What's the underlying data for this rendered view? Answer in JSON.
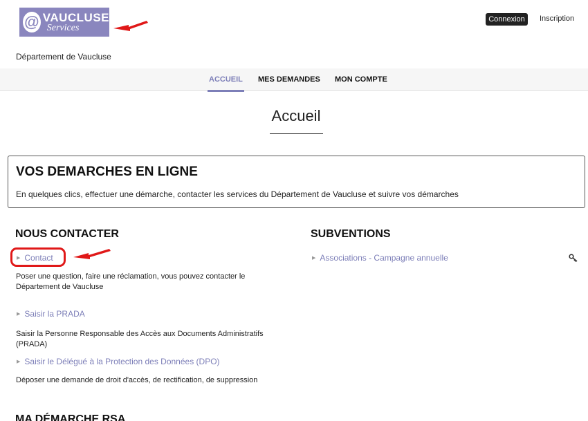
{
  "header": {
    "logo": {
      "at_symbol": "@",
      "main_text": "VAUCLUSE",
      "sub_text": "Services"
    },
    "login_button": "Connexion",
    "signup_link": "Inscription",
    "department": "Département de Vaucluse"
  },
  "nav": {
    "items": [
      {
        "label": "ACCUEIL",
        "active": true
      },
      {
        "label": "MES DEMANDES",
        "active": false
      },
      {
        "label": "MON COMPTE",
        "active": false
      }
    ]
  },
  "page_title": "Accueil",
  "demarches_box": {
    "heading": "VOS DEMARCHES EN LIGNE",
    "text": "En quelques clics, effectuer une démarche, contacter les services du Département de Vaucluse et suivre vos démarches"
  },
  "contact_section": {
    "title": "NOUS CONTACTER",
    "items": [
      {
        "label": "Contact",
        "description": "Poser une question, faire une réclamation, vous pouvez contacter le Département de Vaucluse"
      },
      {
        "label": "Saisir la PRADA",
        "description": "Saisir la Personne Responsable des Accès aux Documents Administratifs (PRADA)"
      },
      {
        "label": "Saisir le Délégué à la Protection des Données (DPO)",
        "description": "Déposer une demande de droit d'accès, de rectification, de suppression"
      }
    ]
  },
  "subventions_section": {
    "title": "SUBVENTIONS",
    "items": [
      {
        "label": "Associations - Campagne annuelle",
        "icon": "key-icon"
      }
    ]
  },
  "rsa_section": {
    "title": "MA DÉMARCHE RSA"
  },
  "colors": {
    "accent": "#7d7fb8",
    "logo_bg": "#8a86be",
    "annotation_red": "#e01818",
    "login_bg": "#222222"
  }
}
